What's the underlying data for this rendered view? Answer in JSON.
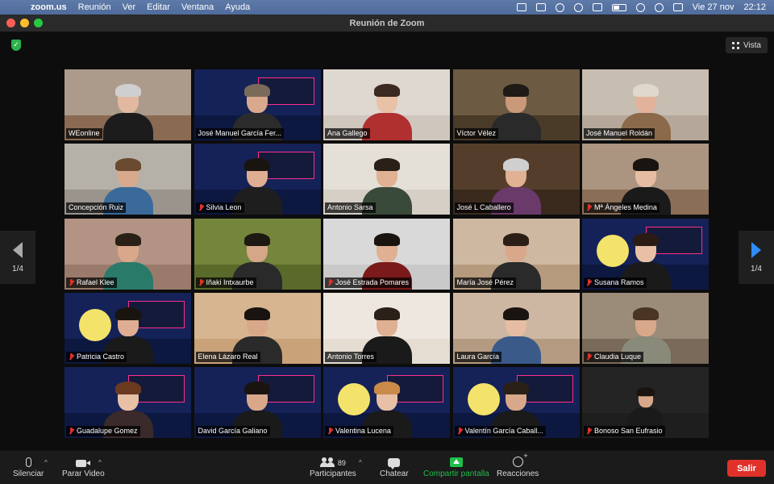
{
  "menubar": {
    "app": "zoom.us",
    "items": [
      "Reunión",
      "Ver",
      "Editar",
      "Ventana",
      "Ayuda"
    ],
    "date": "Vie 27 nov",
    "time": "22:12"
  },
  "window": {
    "title": "Reunión de Zoom"
  },
  "view_button": {
    "label": "Vista"
  },
  "pager": {
    "left": "1/4",
    "right": "1/4"
  },
  "participants": [
    {
      "name": "WEonline",
      "muted": false,
      "bg": "#8a6a52",
      "wall": "#c9c2b8",
      "skin": "#e2b9a0",
      "hair": "#cfcfcf",
      "shirt": "#1c1c1c",
      "theme": "room"
    },
    {
      "name": "José Manuel García Fer...",
      "muted": false,
      "bg": "#0d1840",
      "wall": "#1b2c6b",
      "skin": "#d9a98d",
      "hair": "#7a6a5a",
      "shirt": "#2b2b2b",
      "theme": "poster"
    },
    {
      "name": "Ana Gallego",
      "muted": false,
      "bg": "#cfc6bd",
      "wall": "#ece7e1",
      "skin": "#e9c1a6",
      "hair": "#3a2a20",
      "shirt": "#b03030",
      "theme": "room"
    },
    {
      "name": "Víctor Vélez",
      "muted": false,
      "bg": "#4a3a28",
      "wall": "#8a7457",
      "skin": "#c9997a",
      "hair": "#1e1a16",
      "shirt": "#2a2a2a",
      "theme": "room"
    },
    {
      "name": "José Manuel Roldán",
      "muted": false,
      "bg": "#b5a89a",
      "wall": "#d6cdc2",
      "skin": "#e2b39a",
      "hair": "#e0d8cc",
      "shirt": "#8a6a4a",
      "theme": "room"
    },
    {
      "name": "Concepción Ruiz",
      "muted": false,
      "bg": "#9a948c",
      "wall": "#cdc8bf",
      "skin": "#d8a98c",
      "hair": "#6a4a30",
      "shirt": "#3a6a9a",
      "theme": "room"
    },
    {
      "name": "Silvia Leon",
      "muted": true,
      "bg": "#0d1840",
      "wall": "#1b2c6b",
      "skin": "#dfae92",
      "hair": "#1a1410",
      "shirt": "#1e1e1e",
      "theme": "poster"
    },
    {
      "name": "Antonio Sarsa",
      "muted": false,
      "bg": "#d6cfc6",
      "wall": "#f0ece6",
      "skin": "#e0b293",
      "hair": "#2a2018",
      "shirt": "#3a4a3a",
      "theme": "room"
    },
    {
      "name": "José L Caballero",
      "muted": false,
      "bg": "#3a2a1e",
      "wall": "#6a4e36",
      "skin": "#e0b193",
      "hair": "#cfcfcf",
      "shirt": "#6a3a6a",
      "theme": "room"
    },
    {
      "name": "Mª Ángeles Medina",
      "muted": true,
      "bg": "#8a6e58",
      "wall": "#c9b7a2",
      "skin": "#e6bda3",
      "hair": "#1a1410",
      "shirt": "#1a1a1a",
      "theme": "room"
    },
    {
      "name": "Rafael Klee",
      "muted": true,
      "bg": "#9a7a6a",
      "wall": "#c9a898",
      "skin": "#d9a88a",
      "hair": "#2a2018",
      "shirt": "#2a7a6a",
      "theme": "room"
    },
    {
      "name": "Iñaki Intxaurbe",
      "muted": true,
      "bg": "#5a6a2a",
      "wall": "#8a9a4a",
      "skin": "#d6a688",
      "hair": "#1e1812",
      "shirt": "#2a2a2a",
      "theme": "room"
    },
    {
      "name": "José Estrada Pomares",
      "muted": true,
      "bg": "#c9c9c9",
      "wall": "#e6e6e6",
      "skin": "#e0b093",
      "hair": "#1a1410",
      "shirt": "#7a1a1a",
      "theme": "room"
    },
    {
      "name": "María José Pérez",
      "muted": false,
      "bg": "#b59a7e",
      "wall": "#e2d2bd",
      "skin": "#d9a88a",
      "hair": "#2a1e16",
      "shirt": "#2a2a2a",
      "theme": "room"
    },
    {
      "name": "Susana Ramos",
      "muted": true,
      "bg": "#0d1840",
      "wall": "#1b2c6b",
      "skin": "#e7c0a6",
      "hair": "#2a1c14",
      "shirt": "#1a1a1a",
      "theme": "moon"
    },
    {
      "name": "Patricia Castro",
      "muted": true,
      "bg": "#0d1840",
      "wall": "#1b2c6b",
      "skin": "#dfae92",
      "hair": "#1a1410",
      "shirt": "#1a1a1a",
      "theme": "moon"
    },
    {
      "name": "Elena Lázaro Real",
      "muted": false,
      "bg": "#c9a27a",
      "wall": "#e0c4a2",
      "skin": "#d9a88a",
      "hair": "#1a1410",
      "shirt": "#2a2a2a",
      "theme": "room"
    },
    {
      "name": "Antonio Torres",
      "muted": false,
      "bg": "#e6ddd2",
      "wall": "#f4efe9",
      "skin": "#e0b093",
      "hair": "#2a2018",
      "shirt": "#1a1a1a",
      "theme": "room"
    },
    {
      "name": "Laura García",
      "muted": false,
      "bg": "#b59a82",
      "wall": "#e2d0bd",
      "skin": "#e6bda3",
      "hair": "#1a1410",
      "shirt": "#3a5a8a",
      "theme": "room"
    },
    {
      "name": "Claudia Luque",
      "muted": true,
      "bg": "#7a6a5a",
      "wall": "#b5a894",
      "skin": "#d9a88a",
      "hair": "#4a3424",
      "shirt": "#8a8a7a",
      "theme": "room"
    },
    {
      "name": "Guadalupe Gomez",
      "muted": true,
      "bg": "#0d1840",
      "wall": "#1b2c6b",
      "skin": "#e7c0a6",
      "hair": "#6a3a20",
      "shirt": "#3a2a2a",
      "theme": "poster"
    },
    {
      "name": "David García Galiano",
      "muted": false,
      "bg": "#0d1840",
      "wall": "#1b2c6b",
      "skin": "#d9a88a",
      "hair": "#1a1410",
      "shirt": "#1a1a1a",
      "theme": "poster"
    },
    {
      "name": "Valentina Lucena",
      "muted": true,
      "bg": "#0d1840",
      "wall": "#1b2c6b",
      "skin": "#e7c0a6",
      "hair": "#c98a4a",
      "shirt": "#1a1a1a",
      "theme": "moon"
    },
    {
      "name": "Valentín García Caball...",
      "muted": true,
      "bg": "#0d1840",
      "wall": "#1b2c6b",
      "skin": "#d9a88a",
      "hair": "#2a2018",
      "shirt": "#1a1a1a",
      "theme": "moon"
    },
    {
      "name": "Bonoso San Eufrasio",
      "muted": true,
      "bg": "#1e1e1e",
      "wall": "#2a2a2a",
      "skin": "#d9a88a",
      "hair": "#1a1410",
      "shirt": "#1a1a1a",
      "theme": "small"
    }
  ],
  "active_speaker_index": 16,
  "toolbar": {
    "mute": "Silenciar",
    "video": "Parar Video",
    "participants": "Participantes",
    "participant_count": "89",
    "chat": "Chatear",
    "share": "Compartir pantalla",
    "reactions": "Reacciones",
    "leave": "Salir"
  },
  "colors": {
    "accent": "#2d8cff",
    "share_green": "#1fbf4a",
    "leave_red": "#e0322b",
    "active_border": "#d8e35a"
  }
}
